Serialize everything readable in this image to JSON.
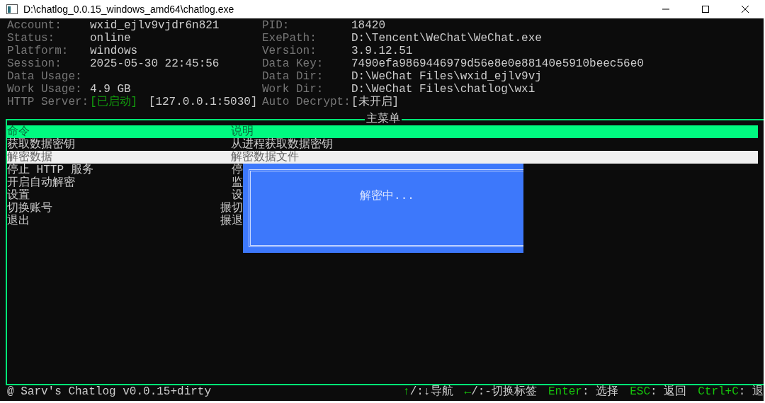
{
  "window": {
    "title": "D:\\chatlog_0.0.15_windows_amd64\\chatlog.exe"
  },
  "info_left": [
    {
      "label": "Account:",
      "value": "wxid_ejlv9vjdr6n821"
    },
    {
      "label": "Status:",
      "value": "online"
    },
    {
      "label": "Platform:",
      "value": "windows"
    },
    {
      "label": "Session:",
      "value": "2025-05-30 22:45:56"
    },
    {
      "label": "Data Usage:"
    },
    {
      "label": "Work Usage:",
      "value": "4.9 GB"
    },
    {
      "label": "HTTP Server:",
      "status": "[已启动]",
      "value": "[127.0.0.1:5030]"
    }
  ],
  "info_right": [
    {
      "label": "PID:",
      "value": "18420"
    },
    {
      "label": "ExePath:",
      "value": "D:\\Tencent\\WeChat\\WeChat.exe"
    },
    {
      "label": "Version:",
      "value": "3.9.12.51"
    },
    {
      "label": "Data Key:",
      "value": "7490efa9869446979d56e8e0e88140e5910beec56e0"
    },
    {
      "label": "Data Dir:",
      "value": "D:\\WeChat Files\\wxid_ejlv9vj"
    },
    {
      "label": "Work Dir:",
      "value": "D:\\WeChat Files\\chatlog\\wxi"
    },
    {
      "label": "Auto Decrypt:",
      "value": "[未开启]"
    }
  ],
  "menu": {
    "title": "主菜单",
    "columns": [
      "命令",
      "说明"
    ],
    "items": [
      {
        "command": "获取数据密钥",
        "description": "从进程获取数据密钥",
        "selected": false
      },
      {
        "command": "解密数据",
        "description": "解密数据文件",
        "selected": true
      },
      {
        "command": "停止 HTTP 服务",
        "description": "停",
        "selected": false
      },
      {
        "command": "开启自动解密",
        "description": "监",
        "selected": false
      },
      {
        "command": "设置",
        "description": "设",
        "selected": false
      },
      {
        "command": "切换账号",
        "description": "搌切",
        "selected": false
      },
      {
        "command": "退出",
        "description": "搌退",
        "selected": false
      }
    ]
  },
  "dialog": {
    "message": "解密中..."
  },
  "footer": {
    "credit": "@ Sarv's Chatlog v0.0.15+dirty",
    "hints": [
      {
        "key": "↑",
        "text": "/:↓导航"
      },
      {
        "key": "←",
        "text": "/:-切换标签"
      },
      {
        "key": "Enter",
        "text": ": 选择"
      },
      {
        "key": "ESC",
        "text": ": 返回"
      },
      {
        "key": "Ctrl+C",
        "text": ": 退"
      }
    ]
  }
}
